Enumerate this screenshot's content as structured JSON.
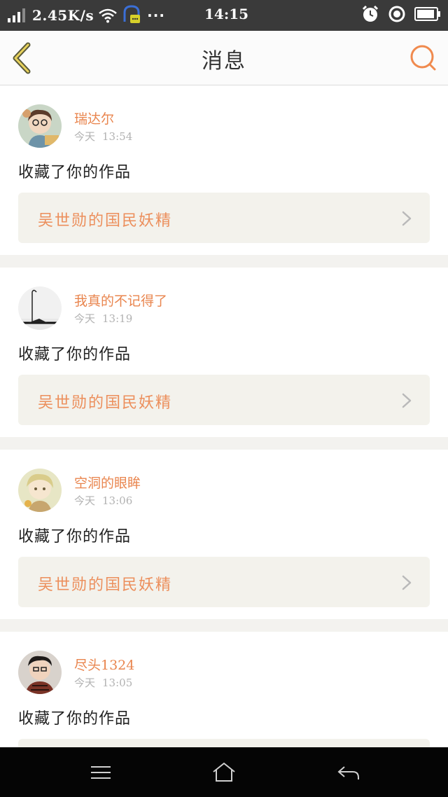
{
  "status_bar": {
    "network_speed": "2.45K/s",
    "dots": "···",
    "time": "14:15"
  },
  "nav": {
    "title": "消息"
  },
  "colors": {
    "accent": "#e9854e",
    "work_text": "#ec8f5c",
    "card_box": "#f3f2ec"
  },
  "messages": [
    {
      "username": "瑞达尔",
      "day": "今天",
      "time": "13:54",
      "action": "收藏了你的作品",
      "work_title": "吴世勋的国民妖精"
    },
    {
      "username": "我真的不记得了",
      "day": "今天",
      "time": "13:19",
      "action": "收藏了你的作品",
      "work_title": "吴世勋的国民妖精"
    },
    {
      "username": "空洞的眼眸",
      "day": "今天",
      "time": "13:06",
      "action": "收藏了你的作品",
      "work_title": "吴世勋的国民妖精"
    },
    {
      "username": "尽头1324",
      "day": "今天",
      "time": "13:05",
      "action": "收藏了你的作品",
      "work_title": ""
    }
  ]
}
